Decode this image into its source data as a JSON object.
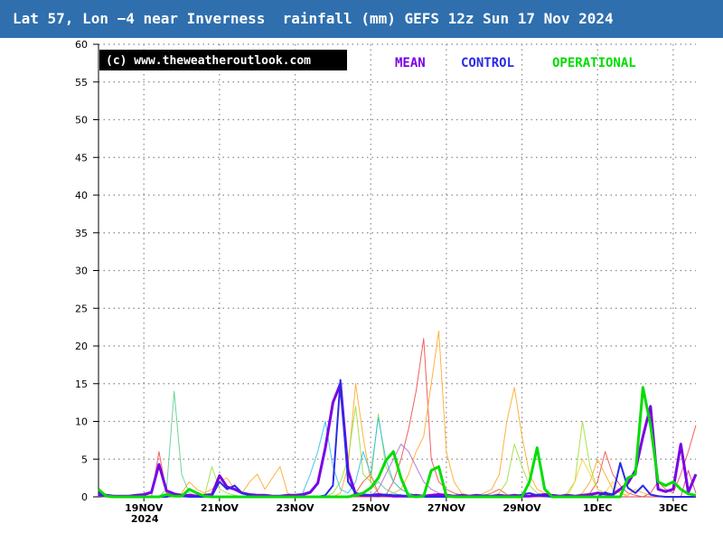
{
  "title": "Lat 57, Lon −4 near Inverness  rainfall (mm) GEFS 12z Sun 17 Nov 2024",
  "credit": "(c) www.theweatheroutlook.com",
  "chart_data": {
    "type": "line",
    "ylim": [
      0,
      60
    ],
    "yticks": [
      0,
      5,
      10,
      15,
      20,
      25,
      30,
      35,
      40,
      45,
      50,
      55,
      60
    ],
    "xlim": [
      0,
      79
    ],
    "xtick_positions": [
      6,
      16,
      26,
      36,
      46,
      56,
      66,
      76
    ],
    "xtick_labels": [
      "19NOV",
      "21NOV",
      "23NOV",
      "25NOV",
      "27NOV",
      "29NOV",
      "1DEC",
      "3DEC"
    ],
    "xtick_sublabels": [
      "2024",
      "",
      "",
      "",
      "",
      "",
      "",
      ""
    ],
    "grid": true,
    "legend_position": "top",
    "series": [
      {
        "name": "MEAN",
        "color": "#7a00e6",
        "width": 3,
        "role": "main",
        "values": [
          0.5,
          0.2,
          0.1,
          0.1,
          0.1,
          0.2,
          0.3,
          0.6,
          4.3,
          0.8,
          0.4,
          0.2,
          0.2,
          0.1,
          0.2,
          0.3,
          2.8,
          1.3,
          1.0,
          0.5,
          0.3,
          0.2,
          0.2,
          0.1,
          0.1,
          0.2,
          0.2,
          0.3,
          0.6,
          1.8,
          6.5,
          12.5,
          15.0,
          3.5,
          0.3,
          0.2,
          0.2,
          0.3,
          0.2,
          0.1,
          0.1,
          0.1,
          0.2,
          0.1,
          0.2,
          0.3,
          0.2,
          0.1,
          0.2,
          0.1,
          0.2,
          0.1,
          0.1,
          0.2,
          0.1,
          0.2,
          0.1,
          0.1,
          0.2,
          0.3,
          0.2,
          0.1,
          0.2,
          0.1,
          0.2,
          0.3,
          0.5,
          0.4,
          0.3,
          1.0,
          1.8,
          3.5,
          8.0,
          12.0,
          1.0,
          0.7,
          1.0,
          7.0,
          0.6,
          3.0
        ]
      },
      {
        "name": "CONTROL",
        "color": "#2a2ae8",
        "width": 2,
        "role": "main",
        "values": [
          0.2,
          0.1,
          0.0,
          0.0,
          0.0,
          0.0,
          0.0,
          0.0,
          0.0,
          0.0,
          0.2,
          0.1,
          0.0,
          0.0,
          0.0,
          0.1,
          2.0,
          1.0,
          1.5,
          0.5,
          0.2,
          0.0,
          0.0,
          0.0,
          0.0,
          0.0,
          0.0,
          0.0,
          0.0,
          0.0,
          0.2,
          1.5,
          15.5,
          2.0,
          0.5,
          0.3,
          0.2,
          0.1,
          0.3,
          0.2,
          0.2,
          0.0,
          0.0,
          0.0,
          0.0,
          0.0,
          0.0,
          0.0,
          0.0,
          0.0,
          0.0,
          0.2,
          0.1,
          0.0,
          0.0,
          0.0,
          0.3,
          0.5,
          0.2,
          0.1,
          0.0,
          0.0,
          0.0,
          0.0,
          0.0,
          0.0,
          0.0,
          0.6,
          0.2,
          4.5,
          1.2,
          0.5,
          1.5,
          0.3,
          0.1,
          0.0,
          0.0,
          0.0,
          0.0,
          0.0
        ]
      },
      {
        "name": "OPERATIONAL",
        "color": "#00dd00",
        "width": 3,
        "role": "main",
        "values": [
          1.0,
          0.1,
          0.0,
          0.0,
          0.0,
          0.0,
          0.0,
          0.0,
          0.0,
          0.3,
          0.1,
          0.1,
          1.0,
          0.5,
          0.1,
          0.0,
          0.0,
          0.0,
          0.0,
          0.0,
          0.0,
          0.0,
          0.0,
          0.0,
          0.0,
          0.0,
          0.0,
          0.0,
          0.0,
          0.0,
          0.0,
          0.0,
          0.0,
          0.0,
          0.2,
          0.5,
          1.2,
          2.5,
          4.8,
          6.0,
          2.5,
          0.1,
          0.0,
          0.1,
          3.5,
          4.0,
          0.1,
          0.0,
          0.0,
          0.0,
          0.0,
          0.0,
          0.0,
          0.0,
          0.0,
          0.0,
          0.0,
          2.0,
          6.5,
          1.0,
          0.0,
          0.0,
          0.0,
          0.0,
          0.0,
          0.0,
          0.0,
          0.0,
          0.0,
          0.0,
          2.5,
          3.0,
          14.5,
          9.5,
          2.0,
          1.5,
          2.0,
          1.0,
          0.4,
          0.2
        ]
      },
      {
        "color": "#ee4444",
        "width": 1,
        "role": "member",
        "values": [
          0.3,
          0.1,
          0.1,
          0.0,
          0.0,
          0.0,
          0.0,
          0.0,
          6.0,
          0.5,
          0.2,
          0.0,
          0.0,
          0.0,
          0.0,
          0.0,
          0.0,
          0.1,
          0.0,
          0.0,
          0.0,
          0.0,
          0.0,
          0.0,
          0.0,
          0.0,
          0.0,
          0.0,
          0.0,
          0.0,
          0.0,
          0.0,
          0.0,
          0.0,
          0.5,
          2.0,
          3.0,
          0.5,
          0.2,
          2.0,
          5.0,
          9.0,
          14.0,
          21.0,
          5.0,
          2.0,
          1.0,
          0.5,
          0.2,
          0.0,
          0.0,
          0.2,
          0.5,
          1.0,
          0.3,
          0.0,
          0.0,
          0.0,
          0.0,
          0.0,
          0.0,
          0.0,
          0.0,
          0.0,
          0.2,
          0.5,
          2.0,
          6.0,
          3.0,
          1.5,
          0.5,
          0.2,
          0.0,
          0.5,
          2.0,
          1.0,
          0.5,
          3.0,
          6.0,
          9.5
        ]
      },
      {
        "color": "#ffa520",
        "width": 1,
        "role": "member",
        "values": [
          0.1,
          0.0,
          0.0,
          0.0,
          0.0,
          0.0,
          0.0,
          0.0,
          0.0,
          0.0,
          0.0,
          0.5,
          2.0,
          1.0,
          0.5,
          1.0,
          2.0,
          2.5,
          1.0,
          0.5,
          2.0,
          3.0,
          1.0,
          2.5,
          4.0,
          0.5,
          0.0,
          0.0,
          0.0,
          0.0,
          0.0,
          0.0,
          0.5,
          4.0,
          15.0,
          8.0,
          2.0,
          0.5,
          0.2,
          0.5,
          1.0,
          3.0,
          6.0,
          8.0,
          15.0,
          22.0,
          6.0,
          2.0,
          0.5,
          0.2,
          0.1,
          0.5,
          1.0,
          3.0,
          10.0,
          14.5,
          8.0,
          3.0,
          1.0,
          0.5,
          0.2,
          0.0,
          0.0,
          0.0,
          0.5,
          2.0,
          5.0,
          3.0,
          1.0,
          0.5,
          0.2,
          1.0,
          0.5,
          0.2,
          0.0,
          0.0,
          0.0,
          0.0,
          0.0,
          0.0
        ]
      },
      {
        "color": "#99dd33",
        "width": 1,
        "role": "member",
        "values": [
          0.2,
          0.1,
          0.0,
          0.0,
          0.0,
          0.0,
          0.0,
          0.0,
          0.0,
          0.0,
          0.0,
          0.0,
          0.0,
          0.0,
          0.0,
          4.0,
          1.0,
          0.5,
          0.2,
          0.0,
          0.0,
          0.0,
          0.0,
          0.0,
          0.0,
          0.0,
          0.0,
          0.0,
          0.0,
          0.0,
          0.0,
          0.5,
          2.0,
          5.0,
          12.0,
          3.0,
          2.0,
          11.0,
          4.0,
          2.0,
          1.0,
          0.5,
          0.2,
          0.0,
          0.0,
          0.0,
          0.0,
          0.0,
          0.0,
          0.0,
          0.0,
          0.0,
          0.0,
          0.5,
          2.0,
          7.0,
          4.0,
          1.5,
          0.5,
          0.0,
          0.0,
          0.0,
          0.5,
          2.0,
          10.0,
          4.0,
          1.0,
          0.5,
          0.0,
          0.0,
          0.0,
          0.0,
          0.0,
          0.0,
          0.0,
          0.0,
          0.0,
          0.0,
          0.0,
          0.0
        ]
      },
      {
        "color": "#22bbee",
        "width": 1,
        "role": "member",
        "values": [
          0.1,
          0.0,
          0.0,
          0.0,
          0.0,
          0.0,
          0.0,
          0.0,
          0.0,
          0.0,
          0.0,
          0.0,
          0.0,
          0.0,
          0.0,
          0.0,
          0.0,
          0.0,
          0.0,
          0.0,
          0.0,
          0.0,
          0.0,
          0.0,
          0.0,
          0.0,
          0.0,
          0.5,
          3.0,
          6.0,
          10.0,
          4.0,
          1.0,
          0.5,
          2.0,
          6.0,
          3.0,
          10.5,
          5.0,
          2.0,
          1.0,
          0.5,
          0.2,
          0.0,
          0.0,
          0.0,
          0.0,
          0.0,
          0.0,
          0.0,
          0.0,
          0.0,
          0.0,
          0.0,
          0.0,
          0.0,
          0.0,
          0.0,
          0.0,
          0.0,
          0.0,
          0.0,
          0.0,
          0.0,
          0.0,
          0.0,
          0.0,
          0.0,
          0.0,
          0.0,
          0.0,
          0.0,
          0.0,
          0.0,
          0.0,
          0.0,
          0.0,
          0.0,
          0.0,
          0.0
        ]
      },
      {
        "color": "#55cc88",
        "width": 1,
        "role": "member",
        "values": [
          0.2,
          0.1,
          0.0,
          0.0,
          0.0,
          0.0,
          0.0,
          0.0,
          0.0,
          1.0,
          14.0,
          3.0,
          0.5,
          0.2,
          0.0,
          0.0,
          0.0,
          0.0,
          0.0,
          0.0,
          0.0,
          0.0,
          0.0,
          0.0,
          0.0,
          0.0,
          0.0,
          0.0,
          0.0,
          0.0,
          0.0,
          0.0,
          0.0,
          0.0,
          0.0,
          0.5,
          1.0,
          2.0,
          1.0,
          0.5,
          0.2,
          0.0,
          0.0,
          0.0,
          0.0,
          0.0,
          0.0,
          0.0,
          0.0,
          0.0,
          0.0,
          0.0,
          0.0,
          0.0,
          0.0,
          0.0,
          0.0,
          0.0,
          0.0,
          0.0,
          0.0,
          0.0,
          0.0,
          0.0,
          0.0,
          0.0,
          0.0,
          0.0,
          0.0,
          0.0,
          0.0,
          0.0,
          0.0,
          0.0,
          0.0,
          0.0,
          0.0,
          0.0,
          0.0,
          0.0
        ]
      },
      {
        "color": "#aa66cc",
        "width": 1,
        "role": "member",
        "values": [
          0.1,
          0.0,
          0.0,
          0.0,
          0.0,
          0.0,
          0.0,
          0.0,
          0.0,
          0.0,
          0.0,
          0.0,
          0.0,
          0.0,
          0.0,
          0.0,
          0.0,
          0.0,
          0.0,
          0.0,
          0.0,
          0.0,
          0.0,
          0.0,
          0.0,
          0.0,
          0.0,
          0.0,
          0.0,
          0.0,
          0.0,
          0.0,
          0.0,
          0.0,
          0.0,
          0.0,
          0.0,
          1.0,
          3.0,
          5.0,
          7.0,
          6.0,
          4.0,
          2.0,
          1.0,
          0.5,
          0.0,
          0.0,
          0.0,
          0.0,
          0.0,
          0.0,
          0.0,
          0.0,
          0.0,
          0.0,
          0.0,
          0.0,
          0.0,
          0.0,
          0.0,
          0.0,
          0.0,
          0.0,
          0.0,
          0.0,
          0.0,
          0.0,
          0.0,
          0.0,
          0.0,
          0.0,
          0.0,
          0.0,
          0.0,
          0.0,
          0.0,
          0.0,
          0.0,
          0.0
        ]
      },
      {
        "color": "#ffcc33",
        "width": 1,
        "role": "member",
        "values": [
          0.1,
          0.0,
          0.0,
          0.0,
          0.0,
          0.0,
          0.0,
          0.0,
          0.0,
          0.0,
          0.0,
          0.0,
          0.0,
          0.0,
          0.0,
          0.0,
          0.0,
          0.0,
          0.0,
          0.0,
          0.0,
          0.0,
          0.0,
          0.0,
          0.0,
          0.0,
          0.0,
          0.0,
          0.0,
          0.0,
          0.0,
          0.0,
          0.0,
          0.0,
          0.0,
          0.0,
          0.0,
          0.0,
          0.0,
          0.0,
          0.0,
          0.0,
          0.0,
          0.0,
          0.0,
          0.0,
          0.0,
          0.0,
          0.0,
          0.0,
          0.0,
          0.0,
          0.0,
          0.0,
          0.0,
          0.0,
          0.0,
          0.0,
          0.0,
          0.0,
          0.0,
          0.0,
          0.0,
          2.0,
          5.0,
          3.0,
          1.0,
          0.5,
          2.0,
          0.5,
          0.0,
          0.0,
          0.0,
          0.0,
          0.0,
          0.0,
          0.0,
          0.0,
          0.0,
          0.0
        ]
      },
      {
        "color": "#cc3366",
        "width": 1,
        "role": "member",
        "values": [
          0.1,
          0.0,
          0.0,
          0.0,
          0.0,
          0.0,
          0.0,
          0.0,
          0.0,
          0.0,
          0.0,
          0.0,
          0.0,
          0.0,
          0.0,
          0.0,
          0.0,
          0.0,
          0.0,
          0.0,
          0.0,
          0.0,
          0.0,
          0.0,
          0.0,
          0.0,
          0.0,
          0.0,
          0.0,
          0.0,
          0.0,
          0.0,
          0.0,
          0.0,
          0.0,
          0.0,
          0.0,
          0.0,
          0.0,
          0.0,
          0.0,
          0.0,
          0.0,
          0.0,
          0.0,
          0.0,
          0.0,
          0.0,
          0.0,
          0.0,
          0.0,
          0.0,
          0.0,
          0.0,
          0.0,
          0.0,
          0.0,
          0.0,
          0.0,
          0.0,
          0.0,
          0.0,
          0.0,
          0.0,
          0.0,
          0.0,
          0.0,
          0.0,
          0.0,
          0.0,
          0.0,
          0.0,
          0.0,
          0.0,
          0.0,
          0.0,
          0.0,
          0.0,
          3.5,
          0.5
        ]
      }
    ]
  }
}
